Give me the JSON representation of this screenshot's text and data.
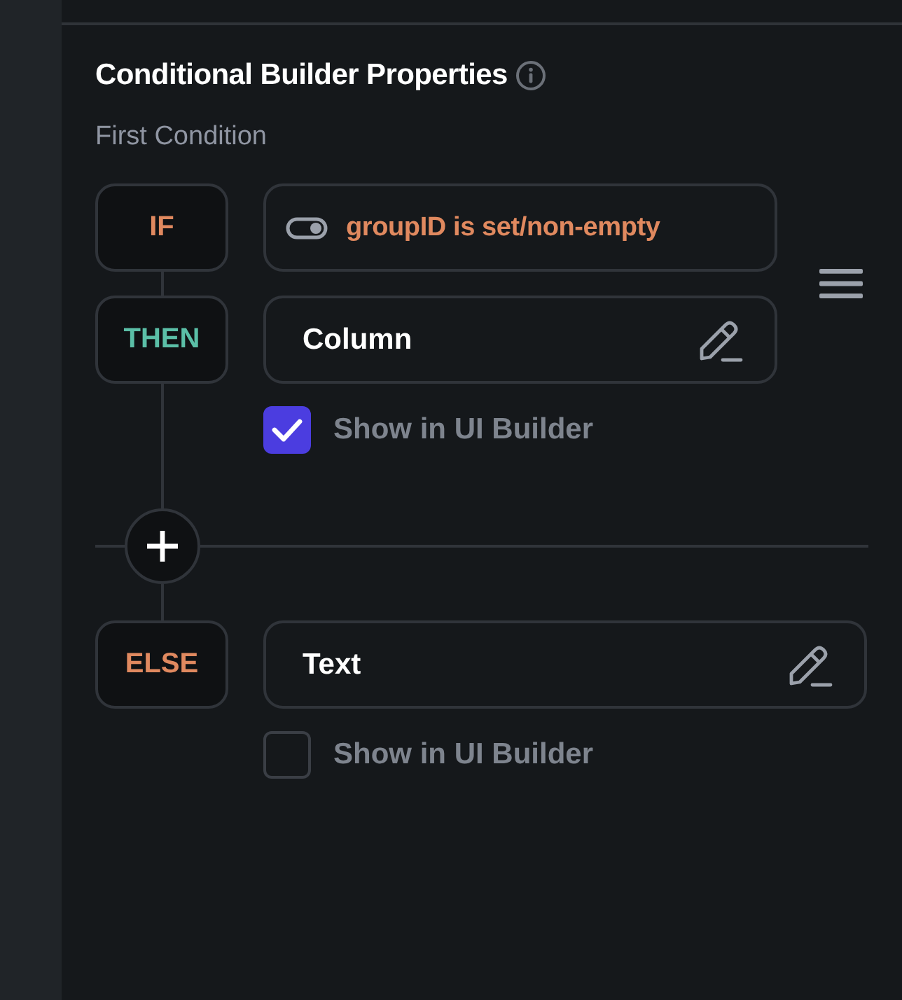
{
  "panel": {
    "title": "Conditional Builder Properties",
    "subtitle": "First Condition"
  },
  "branches": [
    {
      "kind": "if",
      "label": "IF",
      "color": "#e0895f",
      "value": "groupID is set/non-empty"
    },
    {
      "kind": "then",
      "label": "THEN",
      "color": "#5bbfa7",
      "value": "Column",
      "checkbox": {
        "label": "Show in UI Builder",
        "checked": true
      }
    },
    {
      "kind": "else",
      "label": "ELSE",
      "color": "#e0895f",
      "value": "Text",
      "checkbox": {
        "label": "Show in UI Builder",
        "checked": false
      }
    }
  ]
}
